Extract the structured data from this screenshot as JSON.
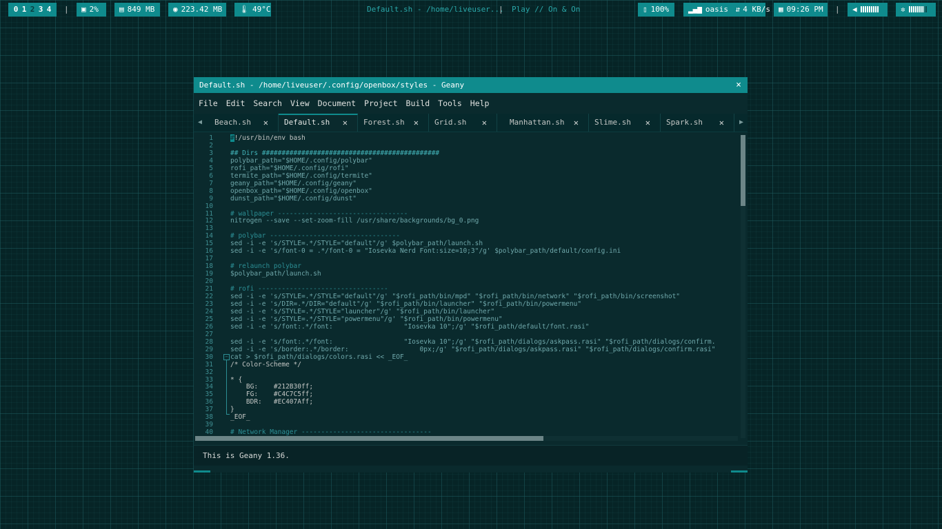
{
  "topbar": {
    "workspaces": [
      "0",
      "1",
      "2",
      "3",
      "4"
    ],
    "active_workspace": "2",
    "cpu_icon": "chip-icon",
    "cpu": "2%",
    "mem_icon": "memory-icon",
    "mem": "849 MB",
    "disk_icon": "disk-icon",
    "disk": "223.42 MB",
    "temp_icon": "thermometer-icon",
    "temp": "49°C",
    "window_title": "Default.sh - /home/liveuser...",
    "mpd": "Play // On & On",
    "battery": "100%",
    "network_name": "oasis",
    "network_speed": "4 KB/s",
    "time": "09:26 PM",
    "separator": "|",
    "accent": "#0f8b8d"
  },
  "window": {
    "title": "Default.sh - /home/liveuser/.config/openbox/styles - Geany",
    "close": "×",
    "menu": [
      "File",
      "Edit",
      "Search",
      "View",
      "Document",
      "Project",
      "Build",
      "Tools",
      "Help"
    ],
    "tabs": [
      {
        "label": "Beach.sh",
        "active": false
      },
      {
        "label": "Default.sh",
        "active": true
      },
      {
        "label": "Forest.sh",
        "active": false
      },
      {
        "label": "Grid.sh",
        "active": false
      },
      {
        "label": "Manhattan.sh",
        "active": false
      },
      {
        "label": "Slime.sh",
        "active": false
      },
      {
        "label": "Spark.sh",
        "active": false
      }
    ],
    "status": "This is Geany 1.36."
  },
  "editor": {
    "lines": [
      "#!/usr/bin/env bash",
      "",
      "## Dirs #############################################",
      "polybar_path=\"$HOME/.config/polybar\"",
      "rofi_path=\"$HOME/.config/rofi\"",
      "termite_path=\"$HOME/.config/termite\"",
      "geany_path=\"$HOME/.config/geany\"",
      "openbox_path=\"$HOME/.config/openbox\"",
      "dunst_path=\"$HOME/.config/dunst\"",
      "",
      "# wallpaper ---------------------------------",
      "nitrogen --save --set-zoom-fill /usr/share/backgrounds/bg_0.png",
      "",
      "# polybar ---------------------------------",
      "sed -i -e 's/STYLE=.*/STYLE=\"default\"/g' $polybar_path/launch.sh",
      "sed -i -e 's/font-0 = .*/font-0 = \"Iosevka Nerd Font:size=10;3\"/g' $polybar_path/default/config.ini",
      "",
      "# relaunch polybar",
      "$polybar_path/launch.sh",
      "",
      "# rofi ---------------------------------",
      "sed -i -e 's/STYLE=.*/STYLE=\"default\"/g' \"$rofi_path/bin/mpd\" \"$rofi_path/bin/network\" \"$rofi_path/bin/screenshot\"",
      "sed -i -e 's/DIR=.*/DIR=\"default\"/g' \"$rofi_path/bin/launcher\" \"$rofi_path/bin/powermenu\"",
      "sed -i -e 's/STYLE=.*/STYLE=\"launcher\"/g' \"$rofi_path/bin/launcher\"",
      "sed -i -e 's/STYLE=.*/STYLE=\"powermenu\"/g' \"$rofi_path/bin/powermenu\"",
      "sed -i -e 's/font:.*/font:                  \"Iosevka 10\";/g' \"$rofi_path/default/font.rasi\"",
      "",
      "sed -i -e 's/font:.*/font:                  \"Iosevka 10\";/g' \"$rofi_path/dialogs/askpass.rasi\" \"$rofi_path/dialogs/confirm.",
      "sed -i -e 's/border:.*/border:                  0px;/g' \"$rofi_path/dialogs/askpass.rasi\" \"$rofi_path/dialogs/confirm.rasi\"",
      "cat > $rofi_path/dialogs/colors.rasi << _EOF_",
      "/* Color-Scheme */",
      "",
      "* {",
      "    BG:    #212B30ff;",
      "    FG:    #C4C7C5ff;",
      "    BDR:   #EC407Aff;",
      "}",
      "_EOF_",
      "",
      "# Network Manager ---------------------------------"
    ]
  }
}
